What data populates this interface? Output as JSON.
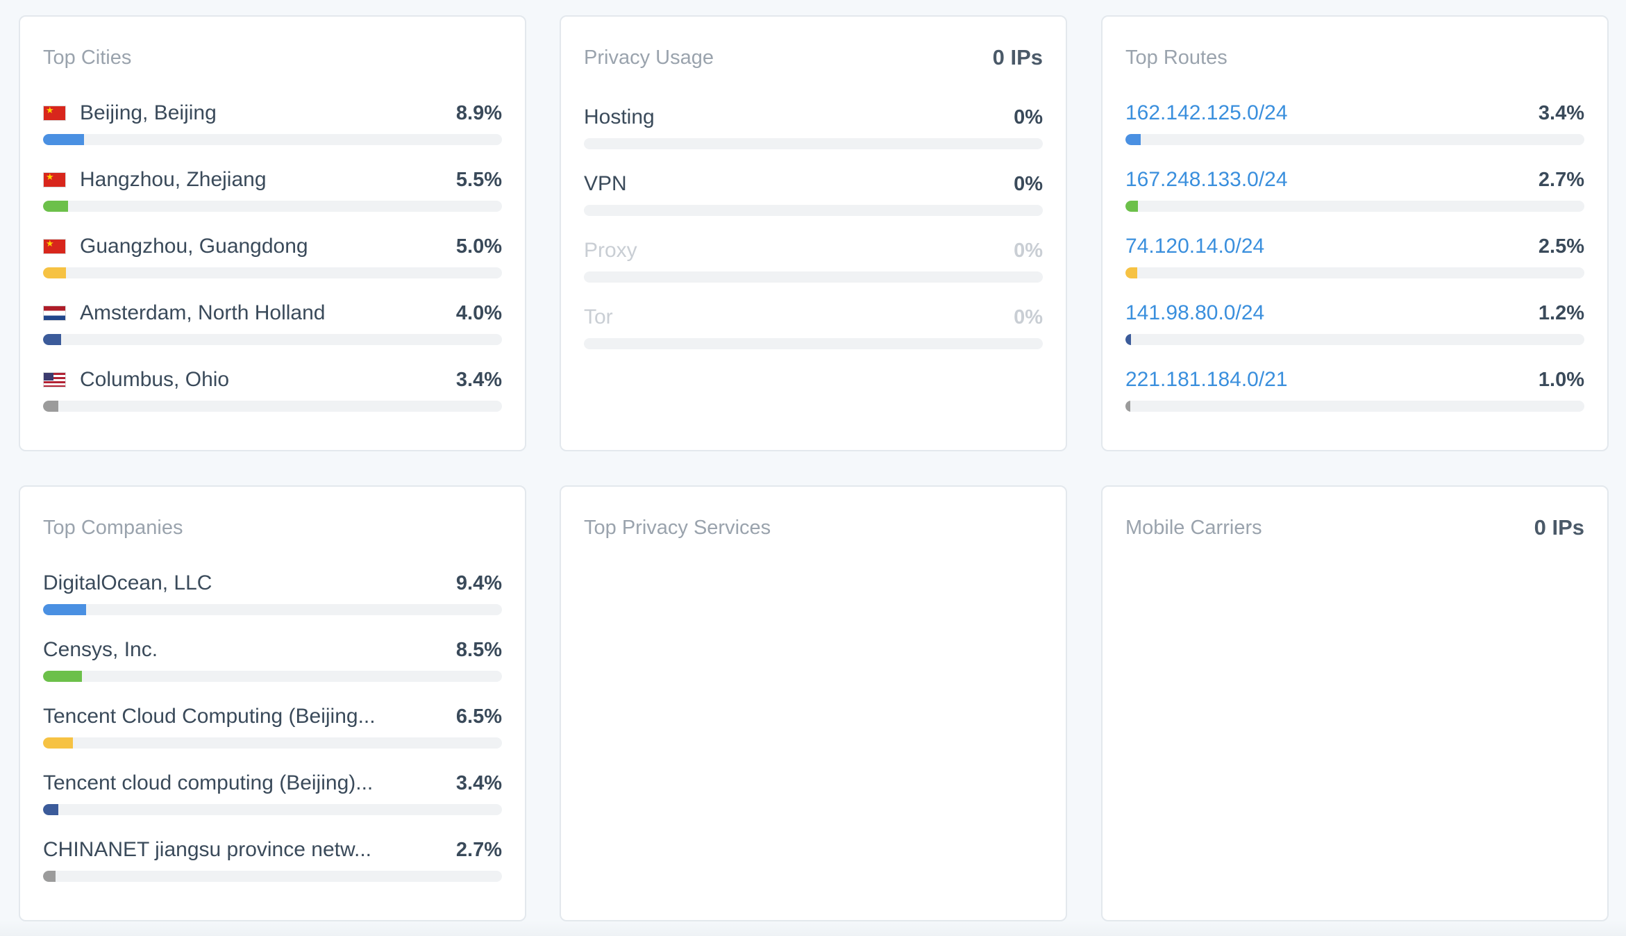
{
  "colors": {
    "blue": "#4a90e2",
    "green": "#6cc04a",
    "yellow": "#f6c243",
    "navy": "#3b5b9a",
    "gray": "#9b9b9b"
  },
  "top_cities": {
    "title": "Top Cities",
    "items": [
      {
        "flag": "cn",
        "label": "Beijing, Beijing",
        "value": "8.9%",
        "pct": 8.9,
        "color": "#4a90e2"
      },
      {
        "flag": "cn",
        "label": "Hangzhou, Zhejiang",
        "value": "5.5%",
        "pct": 5.5,
        "color": "#6cc04a"
      },
      {
        "flag": "cn",
        "label": "Guangzhou, Guangdong",
        "value": "5.0%",
        "pct": 5.0,
        "color": "#f6c243"
      },
      {
        "flag": "nl",
        "label": "Amsterdam, North Holland",
        "value": "4.0%",
        "pct": 4.0,
        "color": "#3b5b9a"
      },
      {
        "flag": "us",
        "label": "Columbus, Ohio",
        "value": "3.4%",
        "pct": 3.4,
        "color": "#9b9b9b"
      }
    ]
  },
  "privacy_usage": {
    "title": "Privacy Usage",
    "total": "0 IPs",
    "items": [
      {
        "label": "Hosting",
        "value": "0%",
        "muted": false
      },
      {
        "label": "VPN",
        "value": "0%",
        "muted": false
      },
      {
        "label": "Proxy",
        "value": "0%",
        "muted": true
      },
      {
        "label": "Tor",
        "value": "0%",
        "muted": true
      }
    ]
  },
  "top_routes": {
    "title": "Top Routes",
    "items": [
      {
        "label": "162.142.125.0/24",
        "value": "3.4%",
        "pct": 3.4,
        "color": "#4a90e2"
      },
      {
        "label": "167.248.133.0/24",
        "value": "2.7%",
        "pct": 2.7,
        "color": "#6cc04a"
      },
      {
        "label": "74.120.14.0/24",
        "value": "2.5%",
        "pct": 2.5,
        "color": "#f6c243"
      },
      {
        "label": "141.98.80.0/24",
        "value": "1.2%",
        "pct": 1.2,
        "color": "#3b5b9a"
      },
      {
        "label": "221.181.184.0/21",
        "value": "1.0%",
        "pct": 1.0,
        "color": "#9b9b9b"
      }
    ]
  },
  "top_companies": {
    "title": "Top Companies",
    "items": [
      {
        "label": "DigitalOcean, LLC",
        "value": "9.4%",
        "pct": 9.4,
        "color": "#4a90e2"
      },
      {
        "label": "Censys, Inc.",
        "value": "8.5%",
        "pct": 8.5,
        "color": "#6cc04a"
      },
      {
        "label": "Tencent Cloud Computing (Beijing...",
        "value": "6.5%",
        "pct": 6.5,
        "color": "#f6c243"
      },
      {
        "label": "Tencent cloud computing (Beijing)...",
        "value": "3.4%",
        "pct": 3.4,
        "color": "#3b5b9a"
      },
      {
        "label": "CHINANET jiangsu province netw...",
        "value": "2.7%",
        "pct": 2.7,
        "color": "#9b9b9b"
      }
    ]
  },
  "top_privacy_services": {
    "title": "Top Privacy Services"
  },
  "mobile_carriers": {
    "title": "Mobile Carriers",
    "total": "0 IPs"
  }
}
